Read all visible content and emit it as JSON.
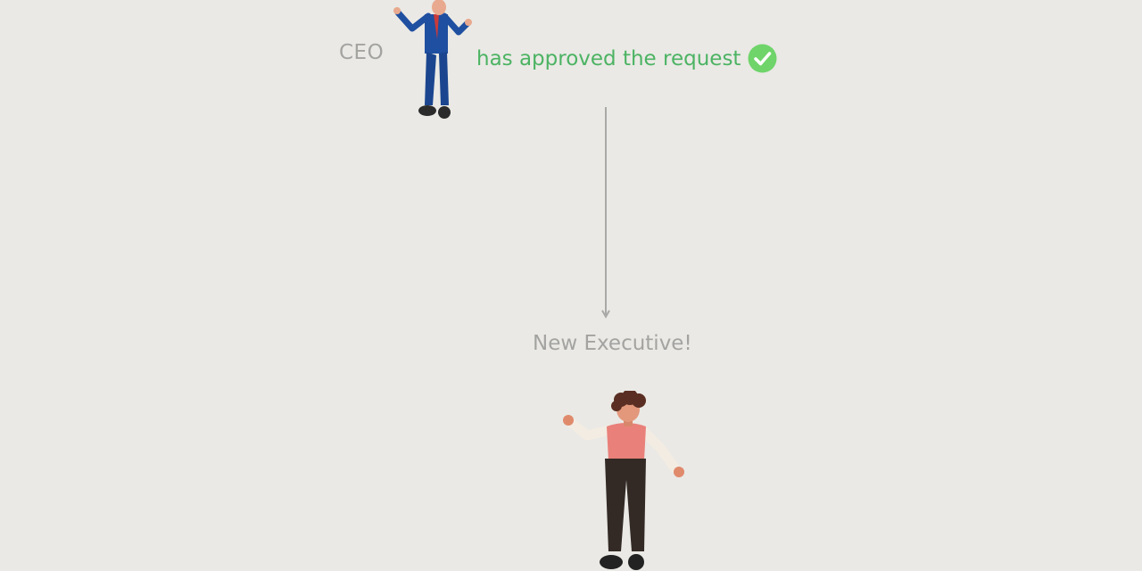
{
  "ceo": {
    "label": "CEO",
    "figure_icon": "ceo-person-figure"
  },
  "approval": {
    "text": "has approved the request",
    "status_icon": "check-circle-icon",
    "color": "#4cb363",
    "icon_color": "#6fd46a"
  },
  "flow": {
    "connector_icon": "down-arrow-icon"
  },
  "new_executive": {
    "label": "New Executive!",
    "figure_icon": "executive-person-figure"
  },
  "colors": {
    "background": "#eae9e5",
    "muted_text": "#a3a3a1",
    "suit_blue": "#1f4fa0",
    "shirt_pink": "#e9807a",
    "pants_dark": "#332a26"
  }
}
